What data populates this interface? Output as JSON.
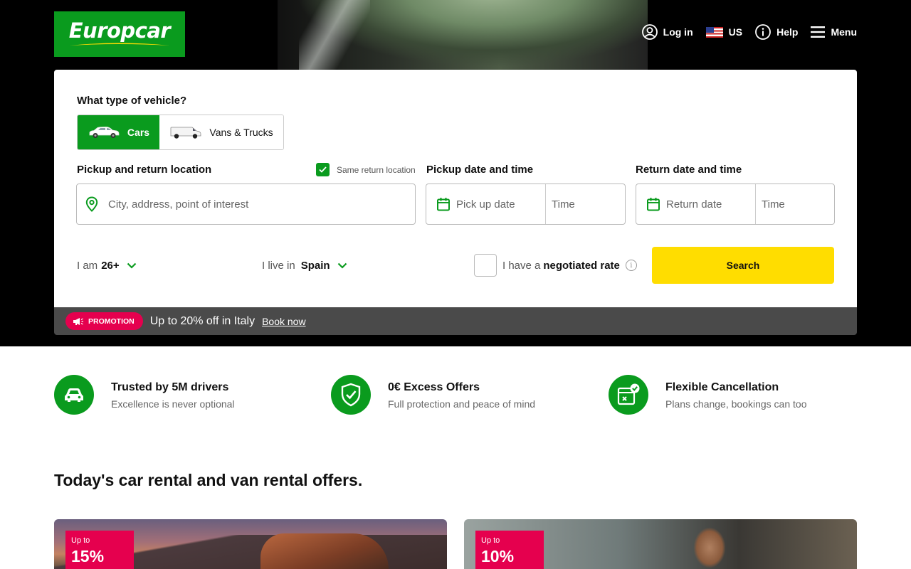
{
  "brand": {
    "name": "Europcar",
    "color": "#0a9b1e"
  },
  "topnav": {
    "login": "Log in",
    "country": "US",
    "help": "Help",
    "menu": "Menu"
  },
  "search": {
    "vehicle_question": "What type of vehicle?",
    "vehicle_tabs": [
      {
        "label": "Cars",
        "selected": true
      },
      {
        "label": "Vans & Trucks",
        "selected": false
      }
    ],
    "location": {
      "label": "Pickup and return location",
      "same_return_label": "Same return location",
      "same_return_checked": true,
      "placeholder": "City, address, point of interest"
    },
    "pickup": {
      "label": "Pickup date and time",
      "date_placeholder": "Pick up date",
      "time_placeholder": "Time"
    },
    "return": {
      "label": "Return date and time",
      "date_placeholder": "Return date",
      "time_placeholder": "Time"
    },
    "age": {
      "prefix": "I am",
      "value": "26+"
    },
    "residence": {
      "prefix": "I live in",
      "value": "Spain"
    },
    "negotiated": {
      "prefix": "I have a",
      "bold": "negotiated rate",
      "checked": false
    },
    "search_button": "Search",
    "search_button_color": "#ffdd00"
  },
  "promo": {
    "badge": "PROMOTION",
    "text": "Up to 20% off in Italy",
    "link": "Book now",
    "badge_color": "#e5004e"
  },
  "benefits": [
    {
      "icon": "car-icon",
      "title": "Trusted by 5M drivers",
      "subtitle": "Excellence is never optional"
    },
    {
      "icon": "shield-check-icon",
      "title": "0€ Excess Offers",
      "subtitle": "Full protection and peace of mind"
    },
    {
      "icon": "calendar-check-icon",
      "title": "Flexible Cancellation",
      "subtitle": "Plans change, bookings can too"
    }
  ],
  "offers_section": {
    "title": "Today's car rental and van rental offers.",
    "offers": [
      {
        "badge_upto": "Up to",
        "badge_value": "15%"
      },
      {
        "badge_upto": "Up to",
        "badge_value": "10%"
      }
    ]
  }
}
